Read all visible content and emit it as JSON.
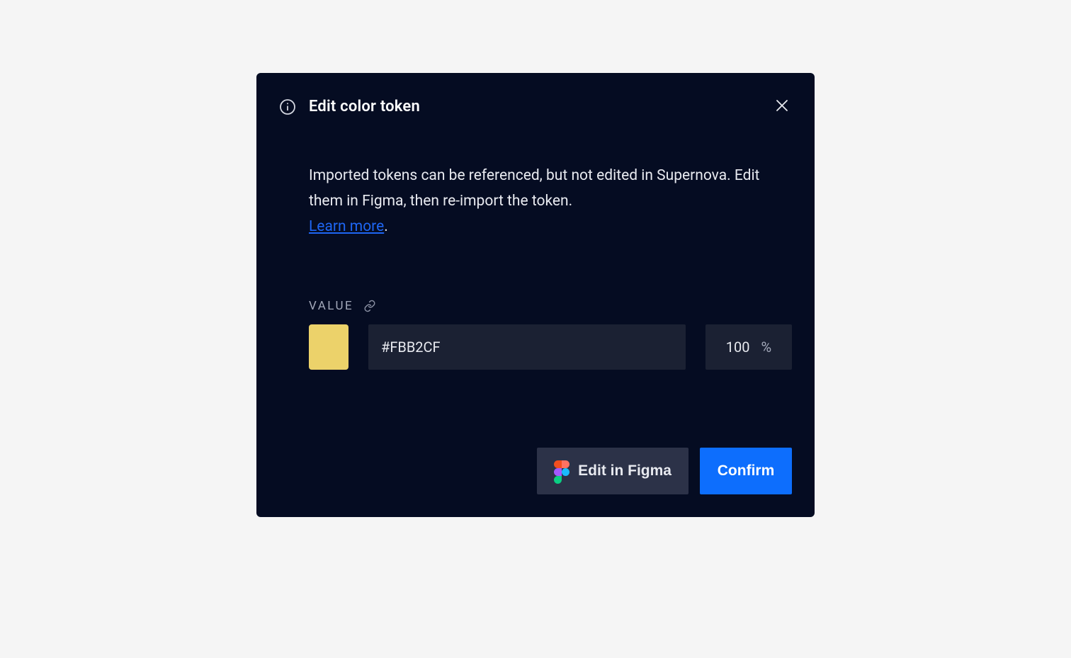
{
  "dialog": {
    "title": "Edit color token",
    "description": "Imported tokens can be referenced, but not edited in Supernova. Edit them in Figma, then re-import the token.",
    "learnMore": "Learn more",
    "valueLabel": "VALUE",
    "hexValue": "#FBB2CF",
    "opacityValue": "100",
    "opacityUnit": "%",
    "swatchColor": "#ecd26a",
    "buttons": {
      "editInFigma": "Edit in Figma",
      "confirm": "Confirm"
    }
  }
}
